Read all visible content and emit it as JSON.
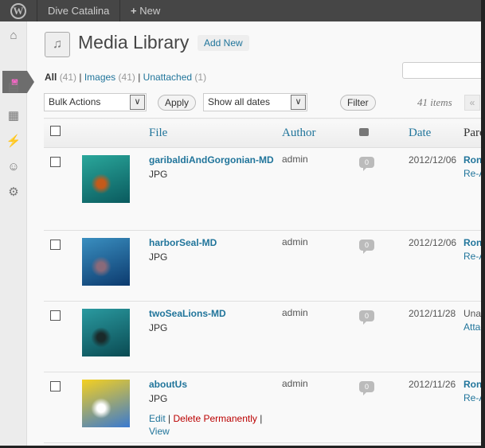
{
  "topbar": {
    "site_name": "Dive Catalina",
    "new_label": "New"
  },
  "page": {
    "title": "Media Library",
    "add_new": "Add New"
  },
  "filters": [
    {
      "label": "All",
      "count": "(41)"
    },
    {
      "label": "Images",
      "count": "(41)"
    },
    {
      "label": "Unattached",
      "count": "(1)"
    }
  ],
  "controls": {
    "bulk_actions": "Bulk Actions",
    "apply": "Apply",
    "dates": "Show all dates",
    "filter": "Filter",
    "items": "41 items",
    "first_page": "«"
  },
  "columns": {
    "file": "File",
    "author": "Author",
    "date": "Date",
    "parent": "Parent"
  },
  "rows": [
    {
      "file": "garibaldiAndGorgonian-MD",
      "type": "JPG",
      "author": "admin",
      "comments": "0",
      "date": "2012/12/06",
      "parent": "Ron",
      "parent_action": "Re-Attach",
      "thumb": [
        "#0a5a5e",
        "#2aa79b",
        "#c45a1a"
      ]
    },
    {
      "file": "harborSeal-MD",
      "type": "JPG",
      "author": "admin",
      "comments": "0",
      "date": "2012/12/06",
      "parent": "Ron",
      "parent_action": "Re-Attach",
      "thumb": [
        "#0c3a6e",
        "#3a8fc0",
        "#8a6a7a"
      ]
    },
    {
      "file": "twoSeaLions-MD",
      "type": "JPG",
      "author": "admin",
      "comments": "0",
      "date": "2012/11/28",
      "parent": "Unattached",
      "parent_action": "Attach",
      "thumb": [
        "#0a4a52",
        "#2a9aa0",
        "#1a2a2a"
      ]
    },
    {
      "file": "aboutUs",
      "type": "JPG",
      "author": "admin",
      "comments": "0",
      "date": "2012/11/26",
      "parent": "Ron",
      "parent_action": "Re-Attach",
      "thumb": [
        "#3a7ad0",
        "#f5d020",
        "#ffffff"
      ],
      "actions": {
        "edit": "Edit",
        "delete": "Delete Permanently",
        "view": "View"
      }
    }
  ]
}
